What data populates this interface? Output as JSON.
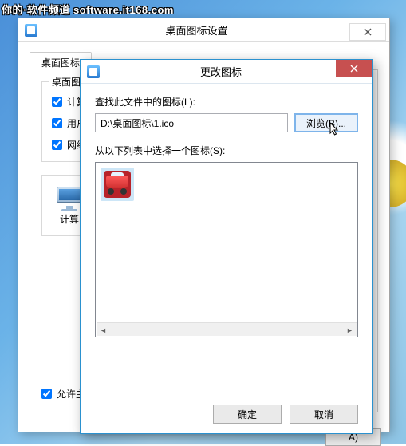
{
  "watermark": "你的·软件频道 software.it168.com",
  "parentDialog": {
    "title": "桌面图标设置",
    "tab": "桌面图标",
    "fieldsetLegend": "桌面图",
    "checkboxes": {
      "computer": "计算",
      "userFiles": "用户",
      "network": "网络"
    },
    "iconLabel": "计算",
    "allowThemes": "允许主",
    "applyBtn": "A)"
  },
  "childDialog": {
    "title": "更改图标",
    "searchLabel": "查找此文件中的图标(L):",
    "pathValue": "D:\\桌面图标\\1.ico",
    "browseBtn": "浏览(B)...",
    "selectLabel": "从以下列表中选择一个图标(S):",
    "selectedIcon": "car-icon",
    "okBtn": "确定",
    "cancelBtn": "取消"
  }
}
